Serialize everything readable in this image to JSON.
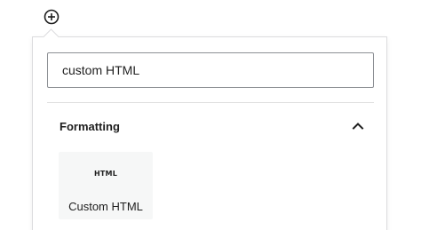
{
  "inserter": {
    "toggle_icon": "plus-circle-icon"
  },
  "search": {
    "value": "custom HTML"
  },
  "panel": {
    "title": "Formatting",
    "expanded": true,
    "toggle_icon": "chevron-up-icon"
  },
  "blocks": [
    {
      "icon_text": "HTML",
      "label": "Custom HTML"
    }
  ]
}
